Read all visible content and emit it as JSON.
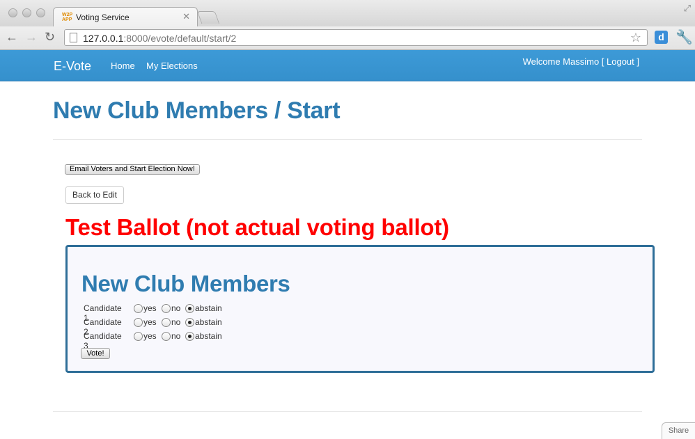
{
  "browser": {
    "tab_title": "Voting Service",
    "favicon_text_top": "W2P",
    "favicon_text_bottom": "APP",
    "url_host": "127.0.0.1",
    "url_rest": ":8000/evote/default/start/2",
    "extension_label": "d"
  },
  "navbar": {
    "brand": "E-Vote",
    "links": [
      "Home",
      "My Elections"
    ],
    "welcome": "Welcome Massimo [ Logout ]"
  },
  "main": {
    "title": "New Club Members / Start",
    "email_button": "Email Voters and Start Election Now!",
    "back_button": "Back to Edit",
    "test_ballot_heading": "Test Ballot (not actual voting ballot)"
  },
  "ballot": {
    "title": "New Club Members",
    "options": [
      "yes",
      "no",
      "abstain"
    ],
    "selected_option": "abstain",
    "candidates": [
      {
        "name": "Candidate 1"
      },
      {
        "name": "Candidate 2"
      },
      {
        "name": "Candidate 3"
      }
    ],
    "vote_button": "Vote!"
  },
  "share_label": "Share",
  "colors": {
    "navbar": "#3a96d3",
    "title_blue": "#2f7cb0",
    "red_heading": "#ff0000",
    "ballot_border": "#2e6e98"
  }
}
